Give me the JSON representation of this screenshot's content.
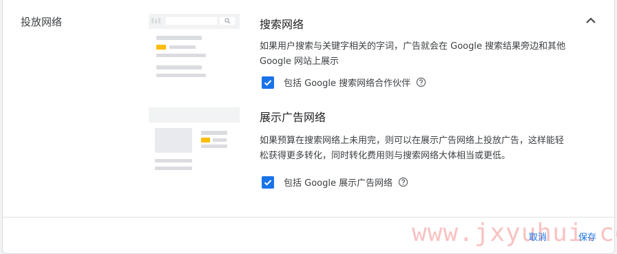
{
  "section": {
    "title": "投放网络"
  },
  "search_network": {
    "heading": "搜索网络",
    "description": "如果用户搜索与关键字相关的字词，广告就会在 Google 搜索结果旁边和其他 Google 网站上展示",
    "checkbox_label": "包括 Google 搜索网络合作伙伴",
    "checked": true
  },
  "display_network": {
    "heading": "展示广告网络",
    "description": "如果预算在搜索网络上未用完，则可以在展示广告网络上投放广告，这样能轻松获得更多转化，同时转化费用则与搜索网络大体相当或更低。",
    "checkbox_label": "包括 Google 展示广告网络",
    "checked": true
  },
  "actions": {
    "cancel": "取消",
    "save": "保存"
  },
  "watermark": "www.jxyuhui.com",
  "colors": {
    "accent": "#1a73e8",
    "ad_highlight": "#fbbc04",
    "placeholder": "#dadce0"
  }
}
